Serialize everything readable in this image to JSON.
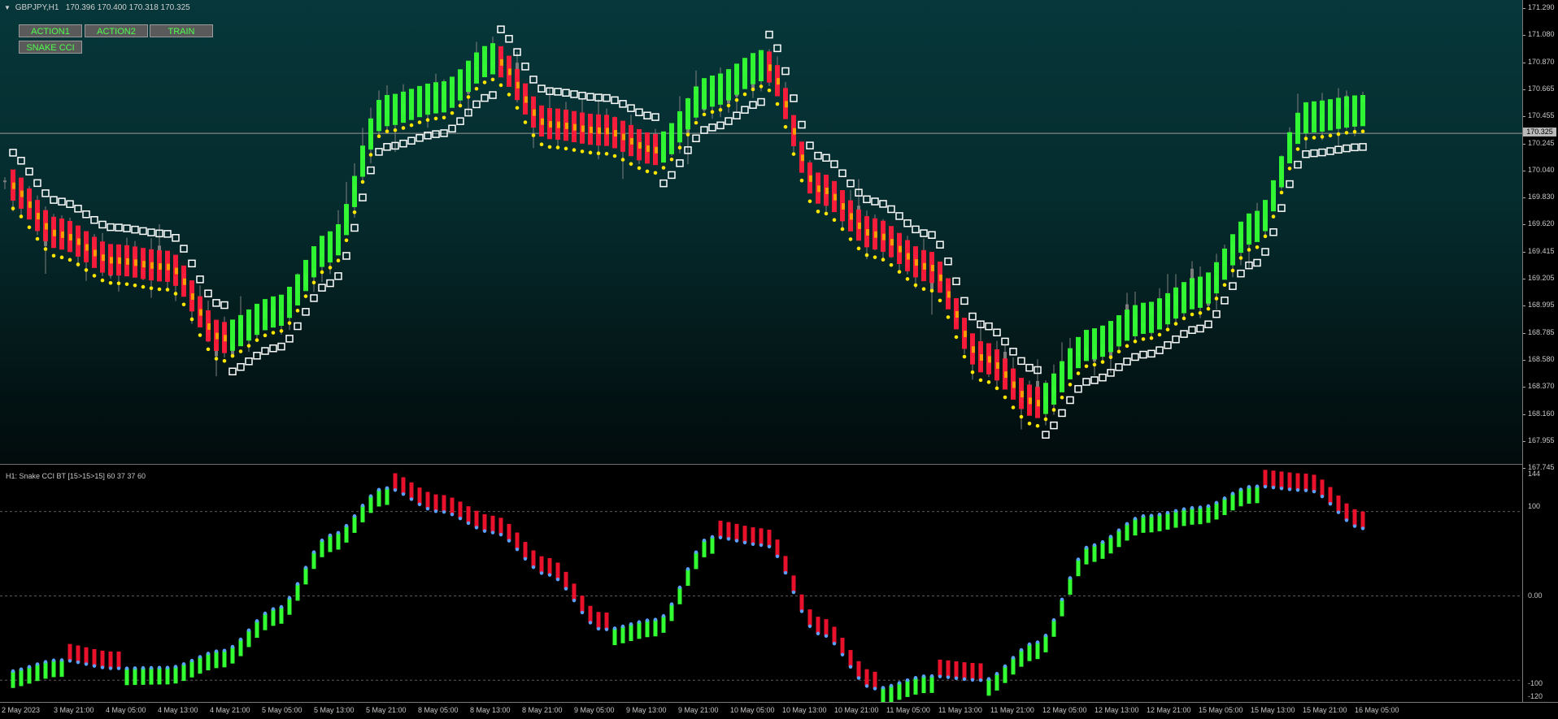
{
  "ticker": {
    "symbol_line": "GBPJPY,H1",
    "ohlc": "170.396 170.400 170.318 170.325"
  },
  "buttons": {
    "action1": "ACTION1",
    "action2": "ACTION2",
    "train": "TRAIN",
    "snake_cci": "SNAKE CCI"
  },
  "current_price": "170.325",
  "price_axis_labels": [
    "171.290",
    "171.080",
    "170.870",
    "170.665",
    "170.455",
    "170.245",
    "170.040",
    "169.830",
    "169.620",
    "169.415",
    "169.205",
    "168.995",
    "168.785",
    "168.580",
    "168.370",
    "168.160",
    "167.955",
    "167.745"
  ],
  "indicator": {
    "title": "H1: Snake CCI BT [15>15>15]  60 37 37 60",
    "levels": [
      "144",
      "100",
      "0.00",
      "-100",
      "-120"
    ]
  },
  "time_labels": [
    "2 May 2023",
    "3 May 21:00",
    "4 May 05:00",
    "4 May 13:00",
    "4 May 21:00",
    "5 May 05:00",
    "5 May 13:00",
    "5 May 21:00",
    "8 May 05:00",
    "8 May 13:00",
    "8 May 21:00",
    "9 May 05:00",
    "9 May 13:00",
    "9 May 21:00",
    "10 May 05:00",
    "10 May 13:00",
    "10 May 21:00",
    "11 May 05:00",
    "11 May 13:00",
    "11 May 21:00",
    "12 May 05:00",
    "12 May 13:00",
    "12 May 21:00",
    "15 May 05:00",
    "15 May 13:00",
    "15 May 21:00",
    "16 May 05:00"
  ],
  "colors": {
    "bull": "#32ff32",
    "bear": "#e8102a",
    "snake_up": "#32ff32",
    "snake_down": "#ff1a3a",
    "snake_dot": "#ffe600",
    "dots": "#5aa0ff",
    "box": "#ffffff"
  },
  "chart_data": [
    {
      "type": "line",
      "title": "GBPJPY,H1",
      "ylim": [
        167.745,
        171.29
      ],
      "x": [
        "2 May 2023",
        "3 May 21:00",
        "4 May 05:00",
        "4 May 13:00",
        "4 May 21:00",
        "5 May 05:00",
        "5 May 13:00",
        "5 May 21:00",
        "8 May 05:00",
        "8 May 13:00",
        "8 May 21:00",
        "9 May 05:00",
        "9 May 13:00",
        "9 May 21:00",
        "10 May 05:00",
        "10 May 13:00",
        "10 May 21:00",
        "11 May 05:00",
        "11 May 13:00",
        "11 May 21:00",
        "12 May 05:00",
        "12 May 13:00",
        "12 May 21:00",
        "15 May 05:00",
        "15 May 13:00",
        "15 May 21:00",
        "16 May 05:00"
      ],
      "series": [
        {
          "values": [
            169.95,
            169.55,
            169.35,
            169.3,
            168.75,
            168.95,
            169.45,
            170.5,
            170.6,
            170.9,
            170.4,
            170.35,
            170.2,
            170.65,
            170.85,
            169.9,
            169.55,
            169.3,
            168.6,
            168.25,
            168.7,
            168.9,
            169.1,
            169.6,
            170.45,
            170.5,
            null
          ]
        }
      ],
      "grid": false
    },
    {
      "type": "bar",
      "title": "H1: Snake CCI BT [15>15>15]  60 37 37 60",
      "ylim": [
        -120,
        144
      ],
      "x": [
        "2 May 2023",
        "3 May 21:00",
        "4 May 05:00",
        "4 May 13:00",
        "4 May 21:00",
        "5 May 05:00",
        "5 May 13:00",
        "5 May 21:00",
        "8 May 05:00",
        "8 May 13:00",
        "8 May 21:00",
        "9 May 05:00",
        "9 May 13:00",
        "9 May 21:00",
        "10 May 05:00",
        "10 May 13:00",
        "10 May 21:00",
        "11 May 05:00",
        "11 May 13:00",
        "11 May 21:00",
        "12 May 05:00",
        "12 May 13:00",
        "12 May 21:00",
        "15 May 05:00",
        "15 May 13:00",
        "15 May 21:00",
        "16 May 05:00"
      ],
      "series": [
        {
          "values": [
            -90,
            -76,
            -86,
            -85,
            -65,
            -15,
            72,
            128,
            100,
            75,
            25,
            -40,
            -28,
            70,
            60,
            -45,
            -110,
            -95,
            -100,
            -55,
            60,
            95,
            105,
            130,
            125,
            80,
            null
          ]
        }
      ],
      "levels": [
        100,
        0,
        -100
      ]
    }
  ]
}
